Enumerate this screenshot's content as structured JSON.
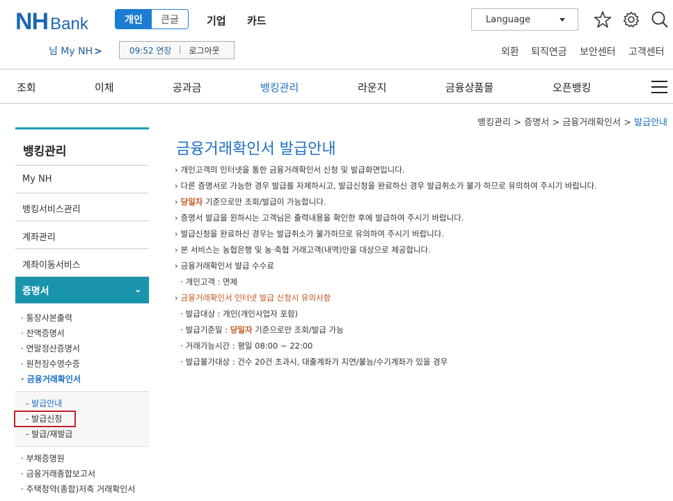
{
  "header": {
    "logo_main": "NH",
    "logo_sub": "Bank",
    "segment": {
      "personal": "개인",
      "large": "큰글"
    },
    "topnav": [
      "기업",
      "카드"
    ],
    "language_label": "Language",
    "user_label": "님 My NH",
    "user_arrow": ">",
    "session_time": "09:52 연장",
    "logout_label": "로그아웃",
    "util_links": [
      "외환",
      "퇴직연금",
      "보안센터",
      "고객센터"
    ]
  },
  "mainnav": [
    "조회",
    "이체",
    "공과금",
    "뱅킹관리",
    "라운지",
    "금융상품몰",
    "오픈뱅킹"
  ],
  "breadcrumb": {
    "items": [
      "뱅킹관리",
      "증명서",
      "금융거래확인서"
    ],
    "separator": ">",
    "current": "발급안내"
  },
  "sidebar": {
    "title": "뱅킹관리",
    "items": [
      "My NH",
      "뱅킹서비스관리",
      "계좌관리",
      "계좌이동서비스"
    ],
    "active": "증명서",
    "active_chevron": "⌄",
    "sub_items": [
      "통장사본출력",
      "잔액증명서",
      "연말정산증명서",
      "원천징수영수증",
      "금융거래확인서"
    ],
    "sub3_items": [
      "발급안내",
      "발급신청",
      "발급/재발급"
    ],
    "sub4_items": [
      "부채증명원",
      "금융거래종합보고서",
      "주택청약(종합)저축 거래확인서"
    ]
  },
  "content": {
    "title": "금융거래확인서 발급안내",
    "bullet": "›",
    "dot": "·",
    "l1": "개인고객의 인터넷을 통한 금융거래확인서 신청 및 발급화면입니다.",
    "l2": "다른 증명서로 가능한 경우 발급를 자제하시고, 발급신청을 완료하신 경우 발급취소가 불가 하므로 유의하여 주시기 바랍니다.",
    "l3_hl": "당일자",
    "l3_rest": "기준으로만 조회/발급이 가능합니다.",
    "l4": "증명서 발급을 원하시는 고객님은 출력내용을 확인한 후에 발급하여 주시기 바랍니다.",
    "l5": "발급신청을 완료하신 경우는 발급취소가 불가하므로 유의하여 주시기 바랍니다.",
    "l6": "본 서비스는 농협은행 및 농·축협 거래고객(내역)만을 대상으로 제공합니다.",
    "l7": "금융거래확인서 발급 수수료",
    "l7a": "개인고객 : 면제",
    "l8": "금융거래확인서 인터넷 발급 신청시 유의사항",
    "l8a": "발급대상 : 개인(개인사업자 포함)",
    "l8b_pre": "발급기준일 :",
    "l8b_hl": "당일자",
    "l8b_rest": "기준으로만 조회/발급 가능",
    "l8c": "거래가능시간 : 평일 08:00 ~ 22:00",
    "l8d": "발급불가대상 : 건수 20건 초과시, 대출계좌가 지연/불능/수기계좌가 있을 경우"
  }
}
